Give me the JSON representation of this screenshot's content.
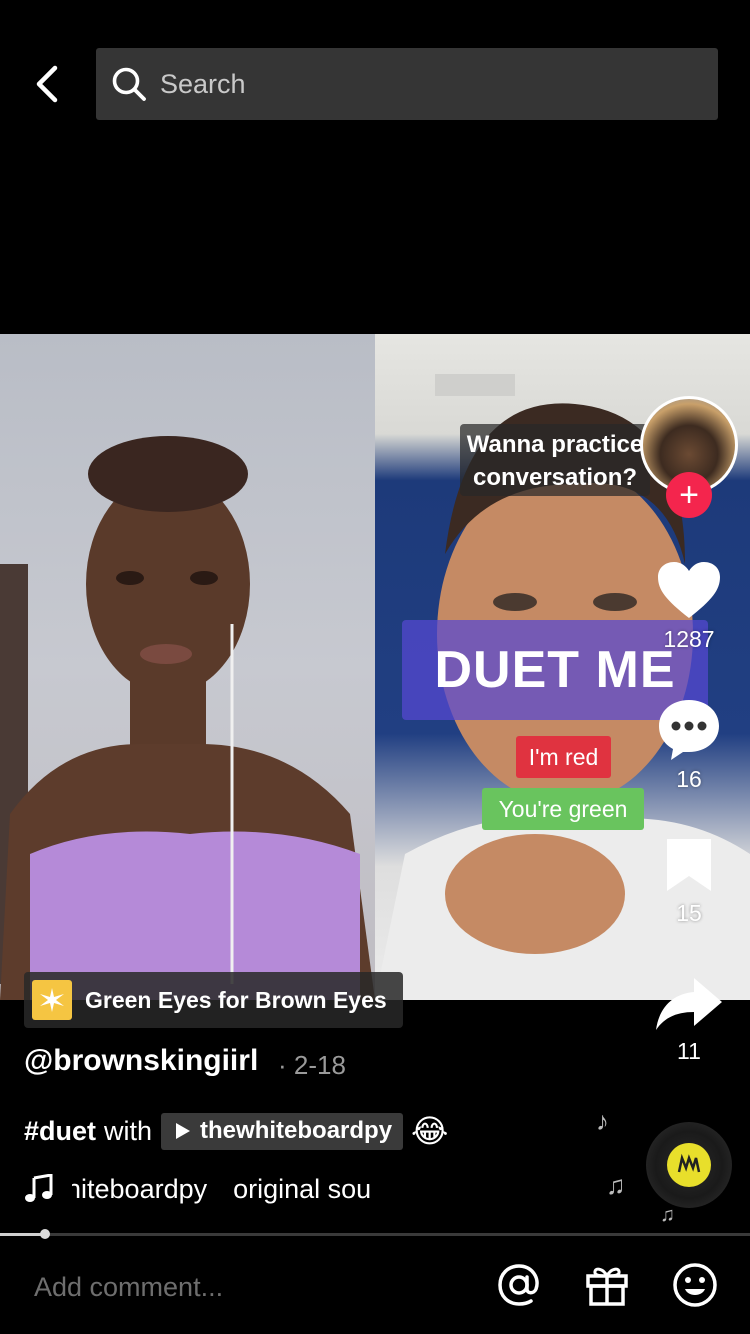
{
  "search": {
    "placeholder": "Search"
  },
  "video": {
    "chat_bubble": "Wanna practice conversation?",
    "duet_text": "DUET ME",
    "tag_red": "I'm red",
    "tag_green": "You're green"
  },
  "actions": {
    "likes": "1287",
    "comments": "16",
    "saves": "15",
    "shares": "11"
  },
  "effect": {
    "label": "Green Eyes for Brown Eyes"
  },
  "post": {
    "username": "@brownskingiirl",
    "date": "· 2-18",
    "hashtag": "#duet",
    "with_text": "with",
    "duet_user": "thewhiteboardpy",
    "emoji": "😂",
    "music_text_1": "hiteboardpy",
    "music_text_2": "original sou"
  },
  "progress": {
    "fraction": 0.06
  },
  "comment": {
    "placeholder": "Add comment..."
  },
  "colors": {
    "accent": "#f4254d",
    "chip_bg": "#3a3a3a",
    "search_bg": "#353535"
  }
}
